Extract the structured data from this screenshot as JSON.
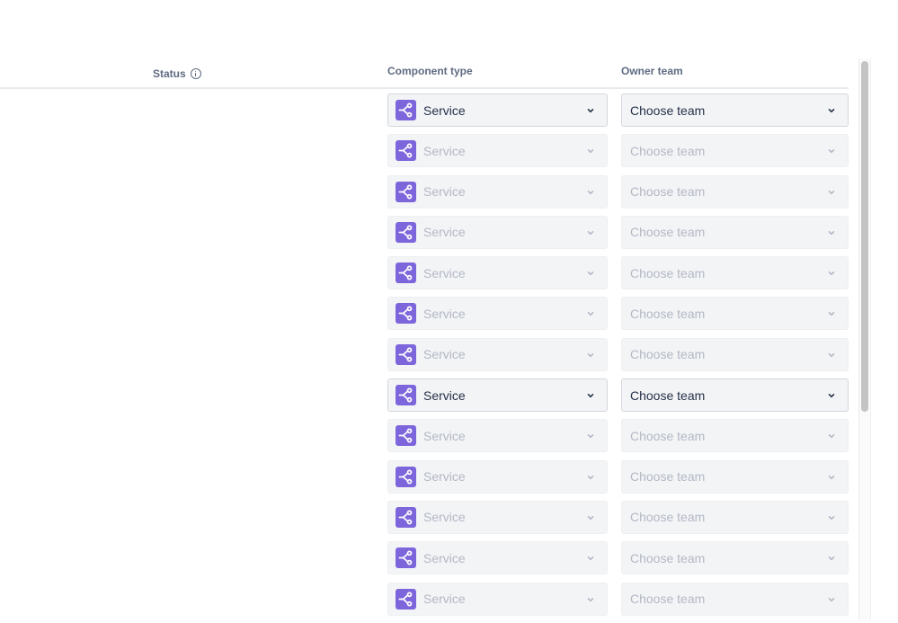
{
  "table": {
    "columns": {
      "status": "Status",
      "component_type": "Component type",
      "owner_team": "Owner team"
    },
    "status_info_icon": "info-circle-icon",
    "rows": [
      {
        "component_type": "Service",
        "owner_team_placeholder": "Choose team",
        "state": "active"
      },
      {
        "component_type": "Service",
        "owner_team_placeholder": "Choose team",
        "state": "disabled"
      },
      {
        "component_type": "Service",
        "owner_team_placeholder": "Choose team",
        "state": "disabled"
      },
      {
        "component_type": "Service",
        "owner_team_placeholder": "Choose team",
        "state": "disabled"
      },
      {
        "component_type": "Service",
        "owner_team_placeholder": "Choose team",
        "state": "disabled"
      },
      {
        "component_type": "Service",
        "owner_team_placeholder": "Choose team",
        "state": "disabled"
      },
      {
        "component_type": "Service",
        "owner_team_placeholder": "Choose team",
        "state": "disabled"
      },
      {
        "component_type": "Service",
        "owner_team_placeholder": "Choose team",
        "state": "active"
      },
      {
        "component_type": "Service",
        "owner_team_placeholder": "Choose team",
        "state": "disabled"
      },
      {
        "component_type": "Service",
        "owner_team_placeholder": "Choose team",
        "state": "disabled"
      },
      {
        "component_type": "Service",
        "owner_team_placeholder": "Choose team",
        "state": "disabled"
      },
      {
        "component_type": "Service",
        "owner_team_placeholder": "Choose team",
        "state": "disabled"
      },
      {
        "component_type": "Service",
        "owner_team_placeholder": "Choose team",
        "state": "disabled"
      }
    ]
  },
  "icons": {
    "component_type": "service-branch-icon",
    "dropdown": "chevron-down-icon"
  },
  "colors": {
    "service_icon_bg": "#7d66dc",
    "active_text": "#263148",
    "disabled_text": "#b3b8c4",
    "header_text": "#5f6b82"
  },
  "scrollbar": {
    "visible_fraction": 0.63,
    "scroll_position": 0
  }
}
